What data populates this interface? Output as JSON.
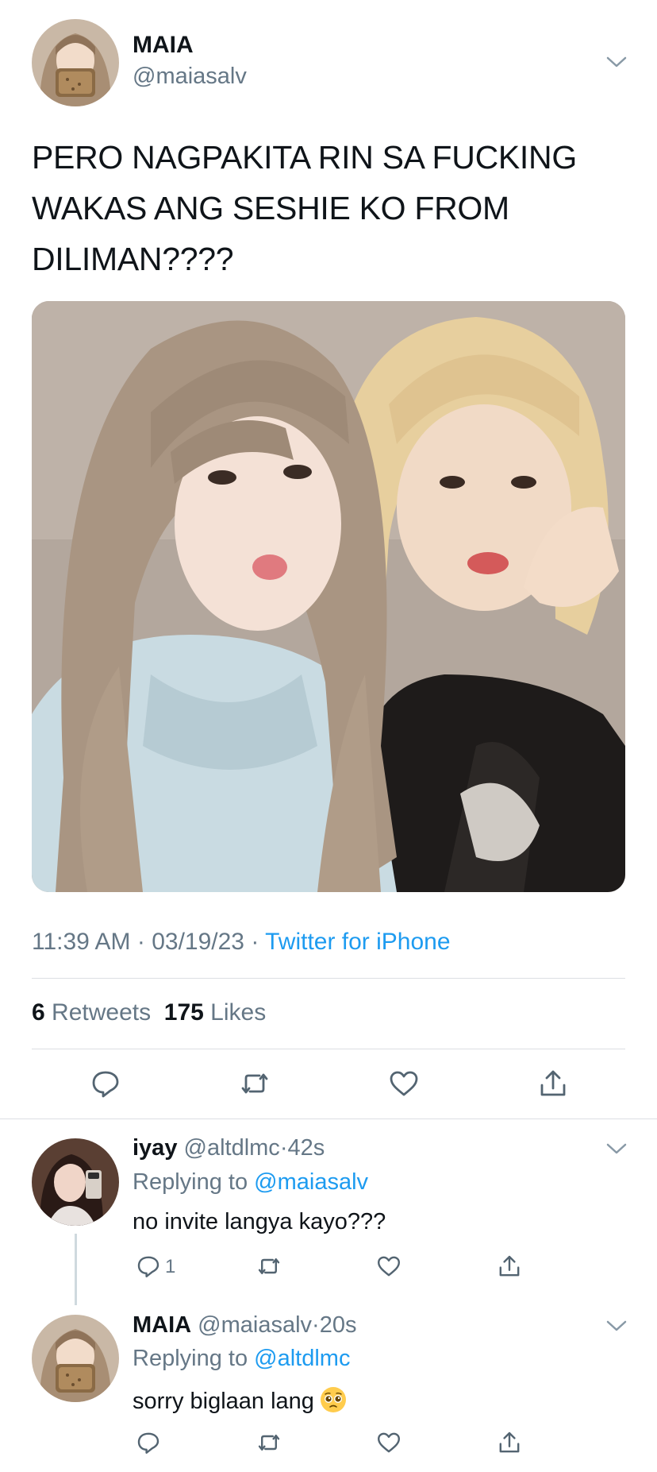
{
  "main_tweet": {
    "name": "MAIA",
    "handle": "@maiasalv",
    "text": "PERO NAGPAKITA RIN SA FUCKING WAKAS ANG SESHIE KO FROM DILIMAN????",
    "time": "11:39 AM",
    "date": "03/19/23",
    "separator": " · ",
    "source": "Twitter for iPhone",
    "retweets_count": "6",
    "retweets_label": "Retweets",
    "likes_count": "175",
    "likes_label": "Likes"
  },
  "replies": [
    {
      "name": "iyay",
      "handle": "@altdlmc",
      "dot": "·",
      "age": "42s",
      "replying_label": "Replying to",
      "replying_to": "@maiasalv",
      "text": "no invite langya kayo???",
      "reply_count": "1"
    },
    {
      "name": "MAIA",
      "handle": "@maiasalv",
      "dot": "·",
      "age": "20s",
      "replying_label": "Replying to",
      "replying_to": "@altdlmc",
      "text": "sorry biglaan lang",
      "emoji": "pleading-face"
    }
  ],
  "icons": {
    "reply": "reply-icon",
    "retweet": "retweet-icon",
    "like": "heart-icon",
    "share": "share-icon",
    "more": "chevron-down-icon"
  },
  "colors": {
    "link": "#1d9bf0",
    "secondary": "#657786",
    "divider": "#dcdfe3"
  }
}
